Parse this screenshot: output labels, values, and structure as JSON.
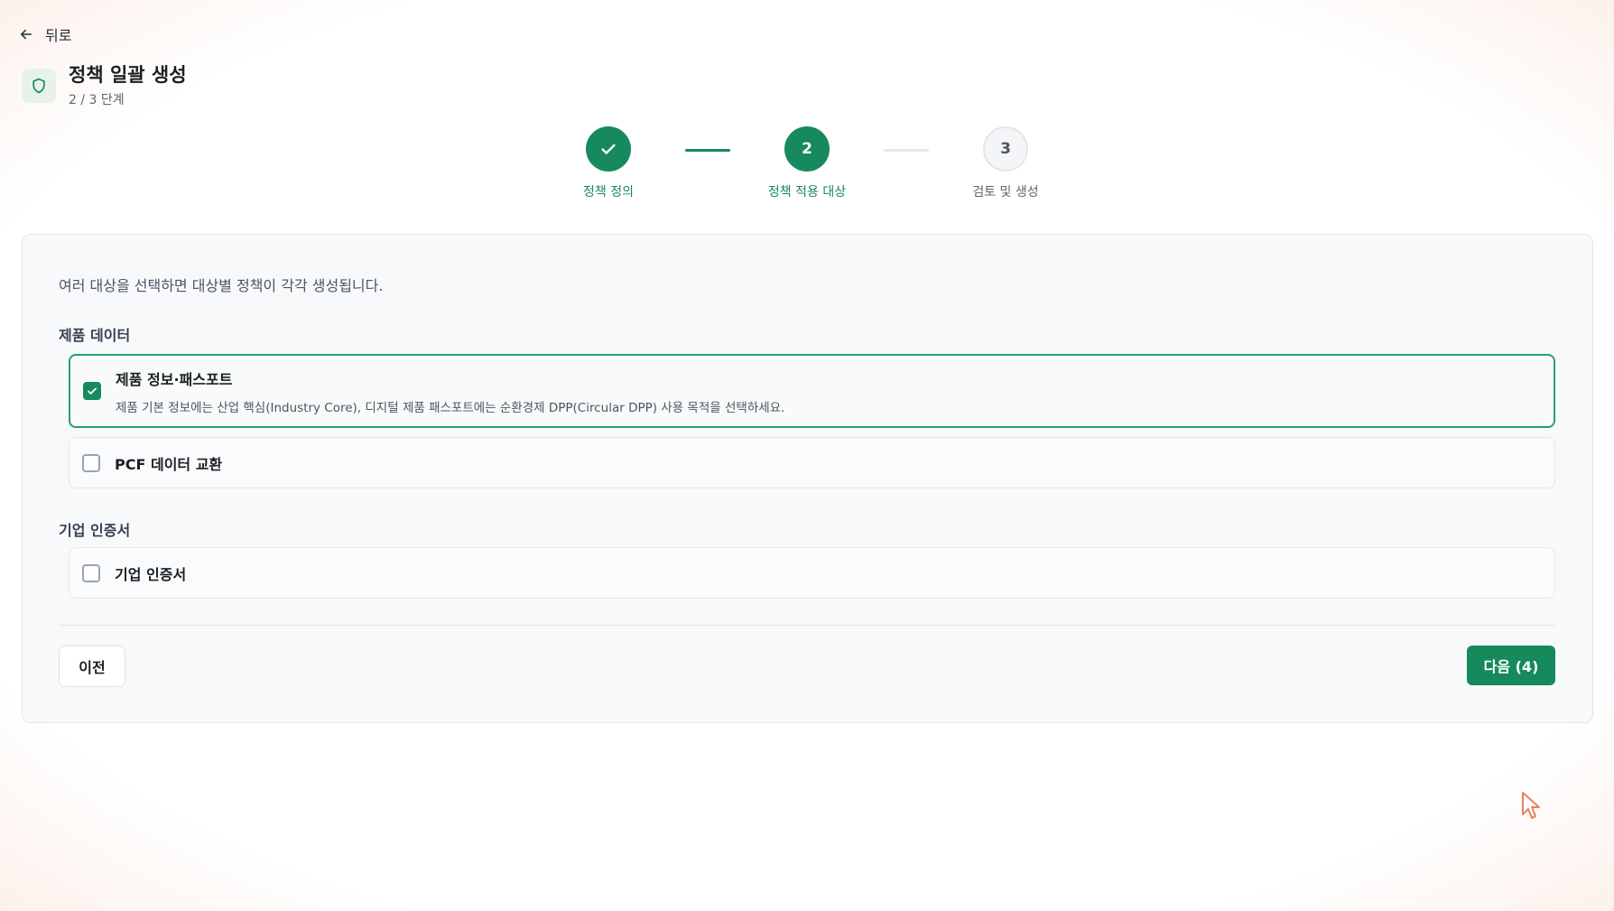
{
  "nav": {
    "back_label": "뒤로"
  },
  "header": {
    "title": "정책 일괄 생성",
    "step_indicator": "2 / 3 단계"
  },
  "stepper": {
    "steps": [
      {
        "label": "정책 정의",
        "status": "done",
        "number": "1"
      },
      {
        "label": "정책 적용 대상",
        "status": "active",
        "number": "2"
      },
      {
        "label": "검토 및 생성",
        "status": "todo",
        "number": "3"
      }
    ]
  },
  "form": {
    "hint": "여러 대상을 선택하면 대상별 정책이 각각 생성됩니다.",
    "sections": [
      {
        "label": "제품 데이터",
        "options": [
          {
            "title": "제품 정보·패스포트",
            "description": "제품 기본 정보에는 산업 핵심(Industry Core), 디지털 제품 패스포트에는 순환경제 DPP(Circular DPP) 사용 목적을 선택하세요.",
            "checked": true
          },
          {
            "title": "PCF 데이터 교환",
            "checked": false
          }
        ]
      },
      {
        "label": "기업 인증서",
        "options": [
          {
            "title": "기업 인증서",
            "checked": false
          }
        ]
      }
    ]
  },
  "actions": {
    "prev_label": "이전",
    "next_label": "다음 (4)"
  },
  "colors": {
    "accent": "#168a5c",
    "border": "#e3e6ea",
    "card_bg": "#f8f9fb"
  },
  "icons": [
    "arrow-left-icon",
    "shield-icon",
    "check-icon",
    "mouse-cursor-icon"
  ]
}
